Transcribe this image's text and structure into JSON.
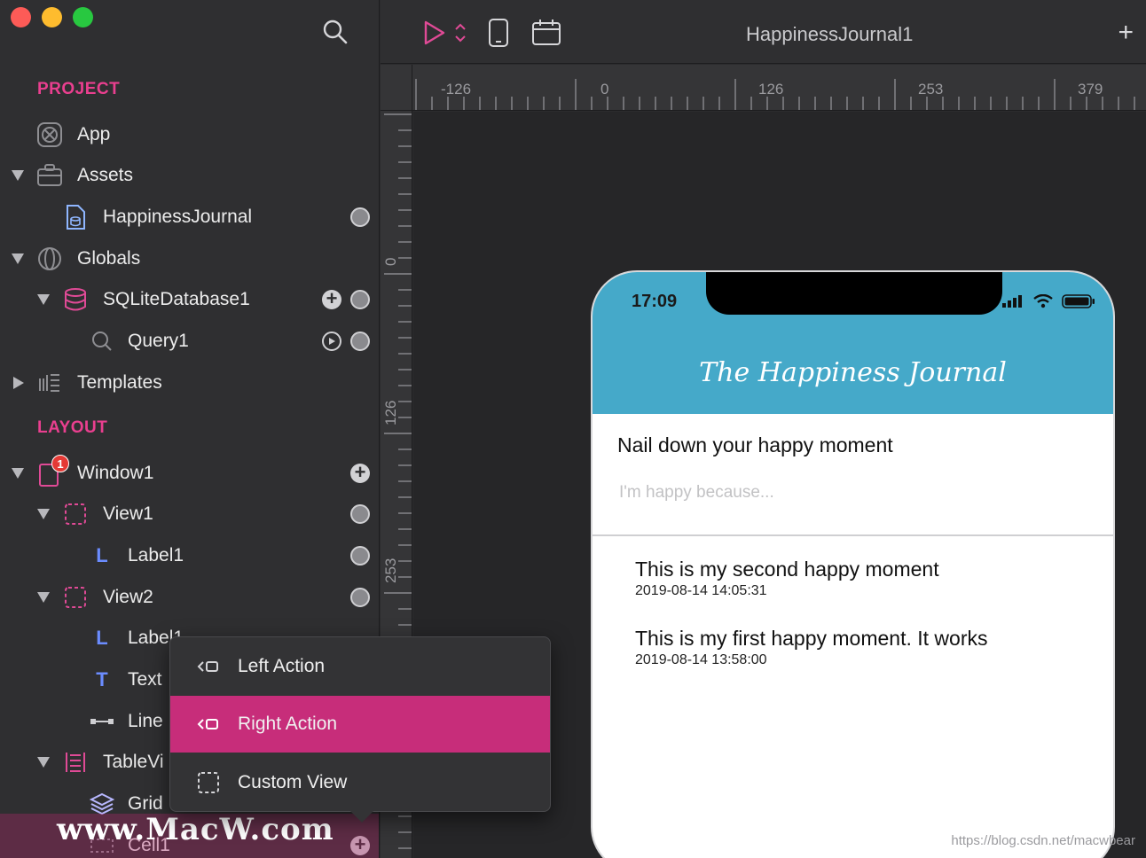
{
  "sidebar": {
    "sections": {
      "project": "PROJECT",
      "layout": "LAYOUT"
    },
    "items": [
      {
        "label": "App"
      },
      {
        "label": "Assets"
      },
      {
        "label": "HappinessJournal"
      },
      {
        "label": "Globals"
      },
      {
        "label": "SQLiteDatabase1"
      },
      {
        "label": "Query1"
      },
      {
        "label": "Templates"
      },
      {
        "label": "Window1",
        "badge": "1"
      },
      {
        "label": "View1"
      },
      {
        "label": "Label1"
      },
      {
        "label": "View2"
      },
      {
        "label": "Label1"
      },
      {
        "label": "Text"
      },
      {
        "label": "Line"
      },
      {
        "label": "TableVi"
      },
      {
        "label": "Grid"
      },
      {
        "label": "Cell1"
      }
    ]
  },
  "toolbar": {
    "title": "HappinessJournal1",
    "add_label": "+"
  },
  "rulers": {
    "horizontal": [
      "-126",
      "0",
      "126",
      "253",
      "379"
    ],
    "vertical": [
      "0",
      "126",
      "253"
    ]
  },
  "phone": {
    "time": "17:09",
    "title": "The Happiness Journal",
    "prompt": "Nail down your happy moment",
    "input_placeholder": "I'm happy because...",
    "entries": [
      {
        "text": "This is my second happy moment",
        "date": "2019-08-14 14:05:31"
      },
      {
        "text": "This is my first happy moment. It works",
        "date": "2019-08-14 13:58:00"
      }
    ]
  },
  "context_menu": {
    "items": [
      {
        "label": "Left Action"
      },
      {
        "label": "Right Action",
        "selected": true
      },
      {
        "label": "Custom View"
      }
    ]
  },
  "watermarks": {
    "macw": "www.MacW.com",
    "csdn": "https://blog.csdn.net/macwbear"
  },
  "colors": {
    "accent": "#ea3f8f",
    "menu_selected": "#c72d7a",
    "phone_header": "#45a9c9"
  }
}
